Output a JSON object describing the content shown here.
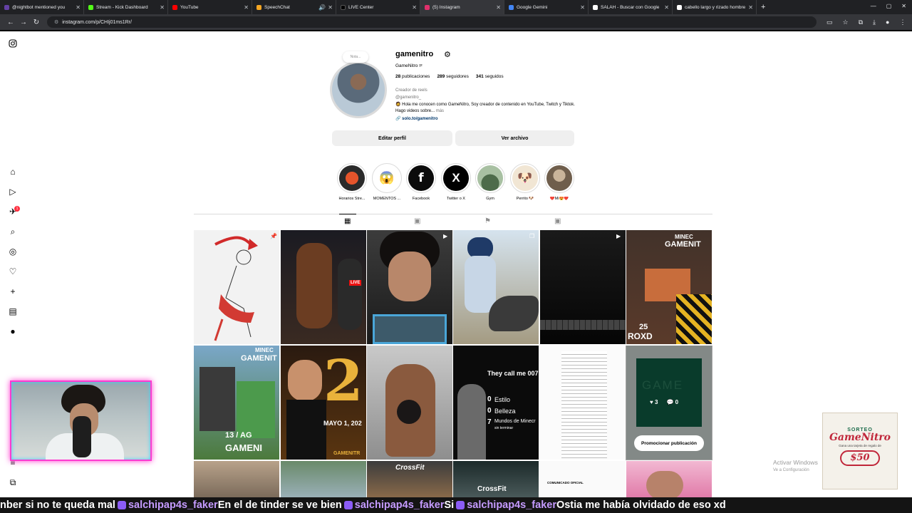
{
  "browser": {
    "tabs": [
      {
        "title": "@nightbot mentioned you",
        "color": "#6441a5"
      },
      {
        "title": "Stream - Kick Dashboard",
        "color": "#53fc18"
      },
      {
        "title": "YouTube",
        "color": "#ff0000"
      },
      {
        "title": "SpeechChat",
        "color": "#f5a623"
      },
      {
        "title": "LIVE Center",
        "color": "#000000"
      },
      {
        "title": "(5) Instagram",
        "color": "#e1306c"
      },
      {
        "title": "Google Gemini",
        "color": "#4285f4"
      },
      {
        "title": "SALAH - Buscar con Google",
        "color": "#ffffff"
      },
      {
        "title": "cabello largo y rizado hombre",
        "color": "#ffffff"
      }
    ],
    "url": "instagram.com/p/CHIj01ms1Rr/"
  },
  "profile": {
    "note": "Nota...",
    "username": "gamenitro",
    "full_name": "GameNitro ᵍᶜ",
    "posts": "28",
    "posts_label": "publicaciones",
    "followers": "289",
    "followers_label": "seguidores",
    "following": "341",
    "following_label": "seguidos",
    "category": "Creador de reels",
    "handle": "@gamenitro_",
    "bio": "🧔 Hola me conocen como GameNitro, Soy creador de contenido en YouTube, Twitch y Tiktok. Hago videos sobre...",
    "bio_more": "más",
    "link": "solo.to/gamenitro",
    "edit_button": "Editar perfil",
    "archive_button": "Ver archivo"
  },
  "highlights": [
    {
      "label": "Horarios Stre...",
      "glyph": "",
      "bg": "#2a2a2a"
    },
    {
      "label": "MOMENTOS ...",
      "glyph": "😱",
      "bg": "#ffffff"
    },
    {
      "label": "Facebook",
      "glyph": "f",
      "bg": "#0b0b0b"
    },
    {
      "label": "Twitter o X",
      "glyph": "X",
      "bg": "#000000"
    },
    {
      "label": "Gym",
      "glyph": "",
      "bg": "#7c9a7a"
    },
    {
      "label": "Perrito 🐶",
      "glyph": "🐶",
      "bg": "#f1e6d4"
    },
    {
      "label": "❤️Mi😍❤️",
      "glyph": "",
      "bg": "#7a6a5a"
    }
  ],
  "grid_texts": {
    "post_live": "LIVE",
    "post_minec_1": "MINEC",
    "post_gamenit_1": "GAMENIT",
    "post_25": "25",
    "post_roxo": "ROXD",
    "post_minec_2": "MINEC",
    "post_gamenit_2": "GAMENIT",
    "post_13": "13 / AG",
    "post_gameni": "GAMENI",
    "post_2": "2",
    "post_mayo": "MAYO 1, 202",
    "post_gamenitr": "GAMENITR",
    "post_they": "They call me 007",
    "post_estilo_n": "0",
    "post_estilo": "Estilo",
    "post_belleza_n": "0",
    "post_belleza": "Belleza",
    "post_mundos_n": "7",
    "post_mundos": "Mundos de Minecr",
    "post_mundos_sub": "sin terminar",
    "post_game": "GAME",
    "post_comunicado": "COMUNICADO OFICIAL",
    "post_crossfit": "CrossFit",
    "post_crossfit2": "CrossFit"
  },
  "hover": {
    "likes": "3",
    "comments": "0",
    "promote": "Promocionar publicación"
  },
  "overlay": {
    "activar": "Activar Windows",
    "activar_sub": "Ve a Configuración",
    "sorteo_top": "SORTEO",
    "sorteo_brand": "GameNitro",
    "sorteo_desc": "Gana una tarjeta de regalo de",
    "sorteo_amount": "$50"
  },
  "ticker": {
    "t1": "nber si no te queda mal ",
    "u1": "salchipap4s_faker",
    "t2": " En el de tinder se ve bien ",
    "u2": "salchipap4s_faker",
    "t3": " Si ",
    "u3": "salchipap4s_faker",
    "t4": " Ostia me había olvidado de eso xd"
  }
}
